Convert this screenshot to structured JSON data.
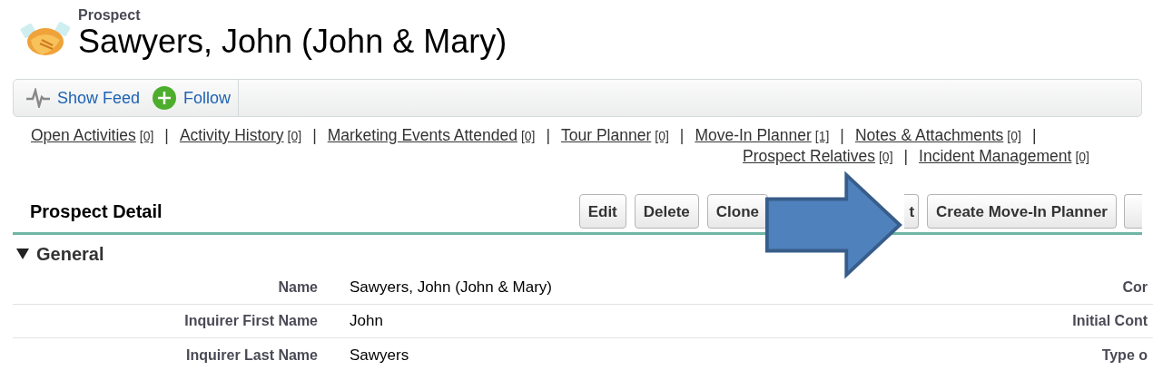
{
  "header": {
    "object_type": "Prospect",
    "title": "Sawyers, John (John & Mary)"
  },
  "feed_bar": [
    {
      "kind": "feed",
      "label": "Show Feed"
    },
    {
      "kind": "follow",
      "label": "Follow"
    }
  ],
  "related_list_rows": [
    [
      {
        "label": "Open Activities",
        "count": "[0]",
        "separator": "|"
      },
      {
        "label": "Activity History",
        "count": "[0]",
        "separator": "|"
      },
      {
        "label": "Marketing Events Attended",
        "count": "[0]",
        "separator": "|"
      },
      {
        "label": "Tour Planner",
        "count": "[0]",
        "separator": "|"
      },
      {
        "label": "Move-In Planner",
        "count": "[1]",
        "separator": "|"
      },
      {
        "label": "Notes & Attachments",
        "count": "[0]",
        "separator": "|"
      }
    ],
    [
      {
        "label": "Prospect Relatives",
        "count": "[0]",
        "separator": "|"
      },
      {
        "label": "Incident Management",
        "count": "[0]"
      }
    ]
  ],
  "detail": {
    "title": "Prospect Detail",
    "buttons": [
      {
        "kind": "full",
        "label": "Edit"
      },
      {
        "kind": "full",
        "label": "Delete"
      },
      {
        "kind": "full",
        "label": "Clone"
      },
      {
        "kind": "covered",
        "label": "t"
      },
      {
        "kind": "full",
        "label": "Create Move-In Planner"
      },
      {
        "kind": "edge"
      }
    ]
  },
  "section": {
    "title": "General",
    "expanded": true,
    "rows": [
      {
        "label": "Name",
        "value": "Sawyers, John (John & Mary)",
        "label_2": "Cor"
      },
      {
        "label": "Inquirer First Name",
        "value": "John",
        "label_2": "Initial Cont"
      },
      {
        "label": "Inquirer Last Name",
        "value": "Sawyers",
        "label_2": "Type o"
      }
    ]
  }
}
